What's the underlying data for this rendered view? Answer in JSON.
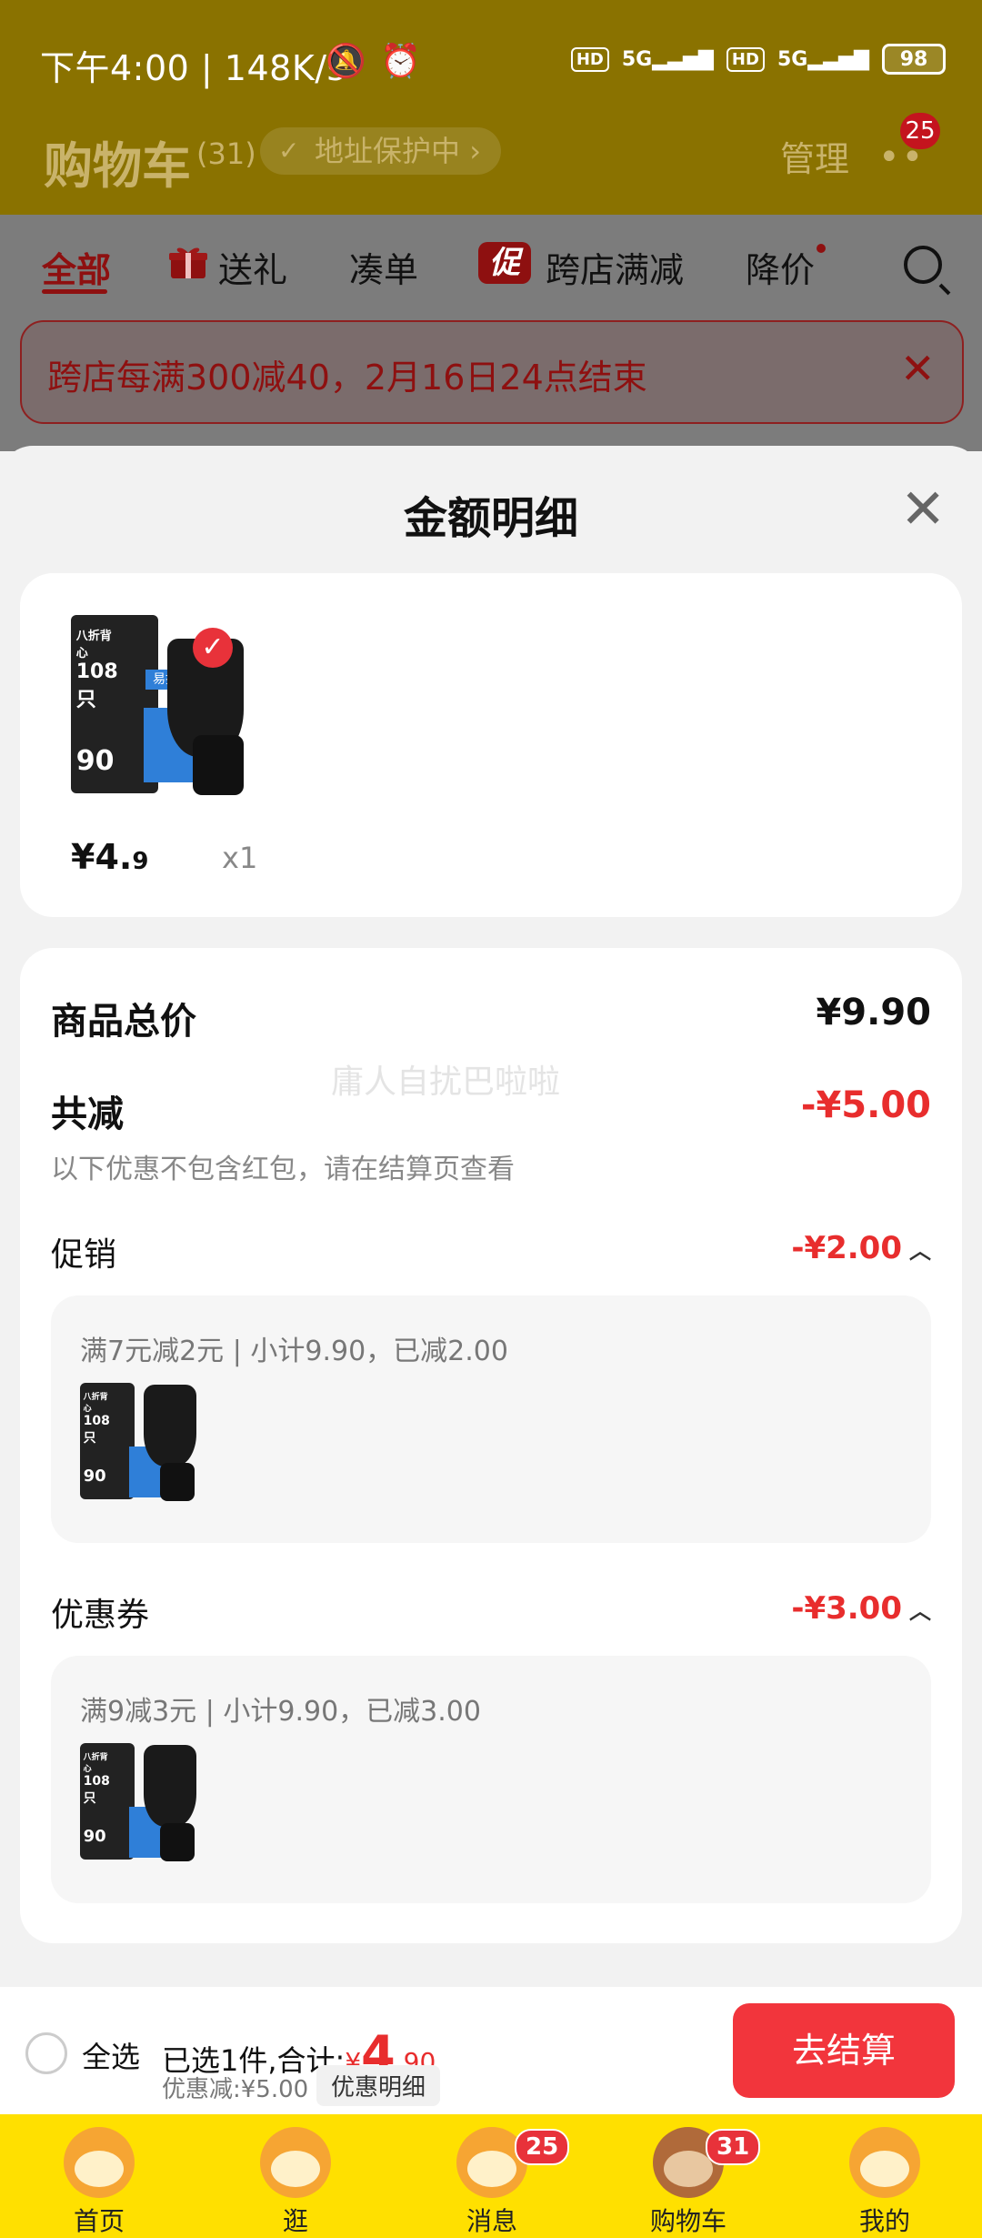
{
  "status_bar": {
    "time_speed": "下午4:00 | 148K/s",
    "network1": "5G",
    "network2": "5G",
    "hd": "HD",
    "battery": "98"
  },
  "header": {
    "title": "购物车",
    "count": "(31)",
    "address": "地址保护中",
    "manage": "管理",
    "more": "••",
    "badge": "25"
  },
  "tabs": {
    "all": "全部",
    "gift": "送礼",
    "combine": "凑单",
    "cross_store_tag": "促",
    "cross_store": "跨店满减",
    "price_drop": "降价"
  },
  "promo_banner": {
    "text": "跨店每满300减40，2月16日24点结束",
    "close": "✕"
  },
  "sheet": {
    "title": "金额明细",
    "close": "✕",
    "item": {
      "price_int": "¥4.",
      "price_dec": "9",
      "qty": "x1",
      "pkg_text1": "八折背心",
      "pkg_text2": "108只",
      "pkg_text3": "90",
      "pkg_text4": "易撕"
    },
    "total_label": "商品总价",
    "total_value": "¥9.90",
    "reduce_label": "共减",
    "reduce_value": "-¥5.00",
    "watermark": "庸人自扰巴啦啦",
    "reduce_note": "以下优惠不包含红包，请在结算页查看",
    "promo_label": "促销",
    "promo_value": "-¥2.00",
    "promo_detail": "满7元减2元 | 小计9.90，已减2.00",
    "coupon_label": "优惠券",
    "coupon_value": "-¥3.00",
    "coupon_detail": "满9减3元 | 小计9.90，已减3.00"
  },
  "checkout": {
    "select_all": "全选",
    "summary_prefix": "已选1件,合计:",
    "currency": "¥",
    "amount_int": "4",
    "amount_dec": ".90",
    "discount": "优惠减:¥5.00",
    "detail_button": "优惠明细",
    "pay_button": "去结算"
  },
  "nav": {
    "items": [
      {
        "label": "首页"
      },
      {
        "label": "逛"
      },
      {
        "label": "消息",
        "badge": "25"
      },
      {
        "label": "购物车",
        "badge": "31"
      },
      {
        "label": "我的"
      }
    ]
  },
  "colors": {
    "accent_red": "#e82d2d",
    "pay_button": "#f2353c",
    "nav_bg": "#ffe000",
    "header_dim": "#8a7200"
  }
}
